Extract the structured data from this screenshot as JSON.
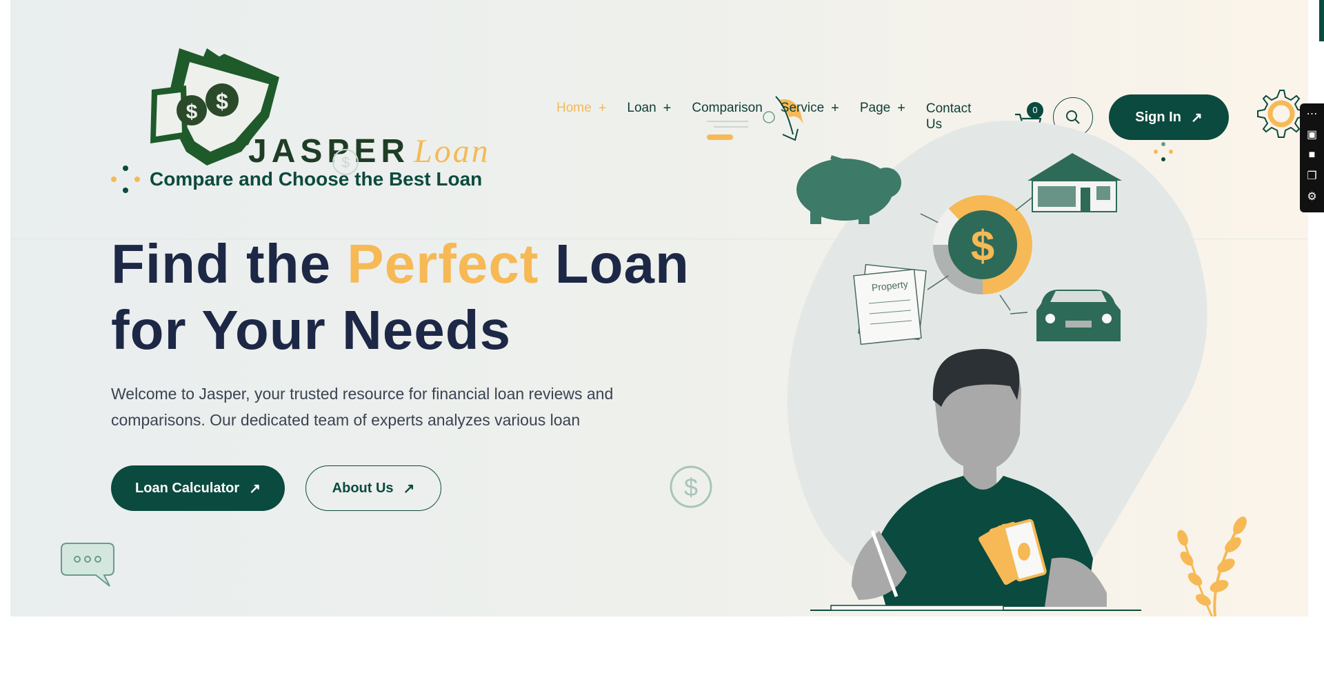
{
  "brand": {
    "logo_main": "JASPER",
    "logo_accent": "Loan",
    "tagline": "Compare and Choose the Best Loan"
  },
  "nav": {
    "items": [
      {
        "label": "Home",
        "plus": "+"
      },
      {
        "label": "Loan",
        "plus": "+"
      },
      {
        "label": "Comparison",
        "plus": ""
      },
      {
        "label": "Service",
        "plus": "+"
      },
      {
        "label": "Page",
        "plus": "+"
      },
      {
        "label": "Contact Us",
        "plus": ""
      }
    ],
    "cart_count": "0",
    "signin_label": "Sign In",
    "signin_arrow": "↗"
  },
  "hero": {
    "headline_1": "Find the ",
    "headline_accent": "Perfect",
    "headline_2": " Loan",
    "headline_3": "for Your Needs",
    "intro": "Welcome to Jasper, your trusted resource for financial loan reviews and comparisons. Our dedicated team of experts analyzes various loan",
    "btn_calc": "Loan Calculator",
    "btn_about": "About Us",
    "btn_arrow": "↗"
  },
  "illustration": {
    "document_label": "Property",
    "dollar": "$"
  },
  "colors": {
    "primary": "#0b4a3e",
    "accent": "#f6b955",
    "heading": "#1d2846"
  }
}
